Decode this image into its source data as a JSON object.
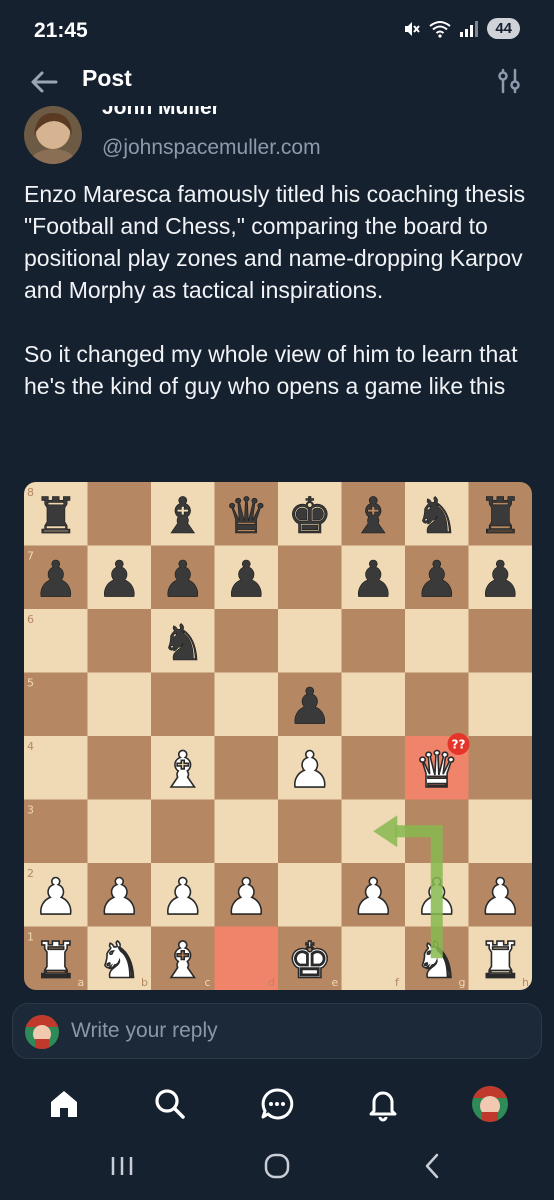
{
  "status_bar": {
    "time": "21:45",
    "battery": "44",
    "icons": [
      "mute-icon",
      "wifi-icon",
      "signal-icon",
      "battery-icon"
    ]
  },
  "header": {
    "title": "Post",
    "back_icon": "arrow-left-icon",
    "filter_icon": "sliders-icon"
  },
  "author": {
    "name": "John Muller",
    "handle": "@johnspacemuller.com"
  },
  "post": {
    "paragraph1": "Enzo Maresca famously titled his coaching thesis \"Football and Chess,\" comparing the board to positional play zones and name-dropping Karpov and Morphy as tactical inspirations.",
    "paragraph2": "So it changed my whole view of him to learn that he's the kind of guy who opens a game like this"
  },
  "board": {
    "ranks": [
      "8",
      "7",
      "6",
      "5",
      "4",
      "3",
      "2",
      "1"
    ],
    "files": [
      "a",
      "b",
      "c",
      "d",
      "e",
      "f",
      "g",
      "h"
    ],
    "position": [
      [
        "r",
        "",
        "b",
        "q",
        "k",
        "b",
        "n",
        "r"
      ],
      [
        "p",
        "p",
        "p",
        "p",
        "",
        "p",
        "p",
        "p"
      ],
      [
        "",
        "",
        "n",
        "",
        "",
        "",
        "",
        ""
      ],
      [
        "",
        "",
        "",
        "",
        "p",
        "",
        "",
        ""
      ],
      [
        "",
        "",
        "B",
        "",
        "P",
        "",
        "Q",
        ""
      ],
      [
        "",
        "",
        "",
        "",
        "",
        "",
        "",
        ""
      ],
      [
        "P",
        "P",
        "P",
        "P",
        "",
        "P",
        "P",
        "P"
      ],
      [
        "R",
        "N",
        "B",
        "",
        "K",
        "",
        "N",
        "R"
      ]
    ],
    "highlights": [
      "d1",
      "g4"
    ],
    "arrow": {
      "from": "g1",
      "to": "f3"
    },
    "move_badge": "??",
    "colors": {
      "light": "#f0d9b5",
      "dark": "#b58863",
      "highlight": "#f0846b",
      "arrow": "#87b84f",
      "badge": "#e5352b"
    }
  },
  "reply": {
    "placeholder": "Write your reply"
  },
  "tabbar": {
    "items": [
      "home-icon",
      "search-icon",
      "chat-icon",
      "bell-icon",
      "profile-avatar"
    ]
  },
  "system_nav": [
    "recents-icon",
    "home-circle-icon",
    "back-chevron-icon"
  ]
}
